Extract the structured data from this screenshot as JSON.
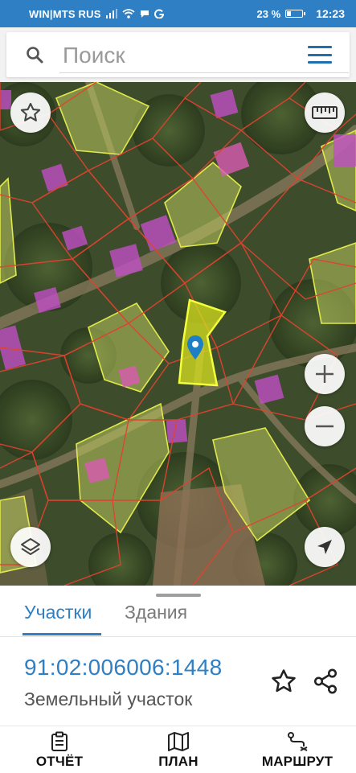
{
  "status_bar": {
    "carrier": "WIN|MTS RUS",
    "battery_percent": "23 %",
    "time": "12:23"
  },
  "search": {
    "placeholder": "Поиск",
    "value": ""
  },
  "map": {
    "icons": [
      "star-icon",
      "ruler-icon",
      "zoom-in-icon",
      "zoom-out-icon",
      "layers-icon",
      "navigation-arrow-icon",
      "location-pin-icon"
    ],
    "colors": {
      "parcel_outline": "#e0432f",
      "selected_parcel": "#d7e21e",
      "highlight_parcel": "#c8d84a",
      "building": "#c04fc6",
      "pin": "#1e7fc4"
    }
  },
  "tabs": [
    {
      "label": "Участки",
      "active": true
    },
    {
      "label": "Здания",
      "active": false
    }
  ],
  "parcel": {
    "number": "91:02:006006:1448",
    "type": "Земельный участок"
  },
  "bottom_nav": [
    {
      "label": "ОТЧЁТ",
      "icon": "report-icon"
    },
    {
      "label": "ПЛАН",
      "icon": "map-plan-icon"
    },
    {
      "label": "МАРШРУТ",
      "icon": "route-icon"
    }
  ],
  "accent_color": "#2f7fc4"
}
